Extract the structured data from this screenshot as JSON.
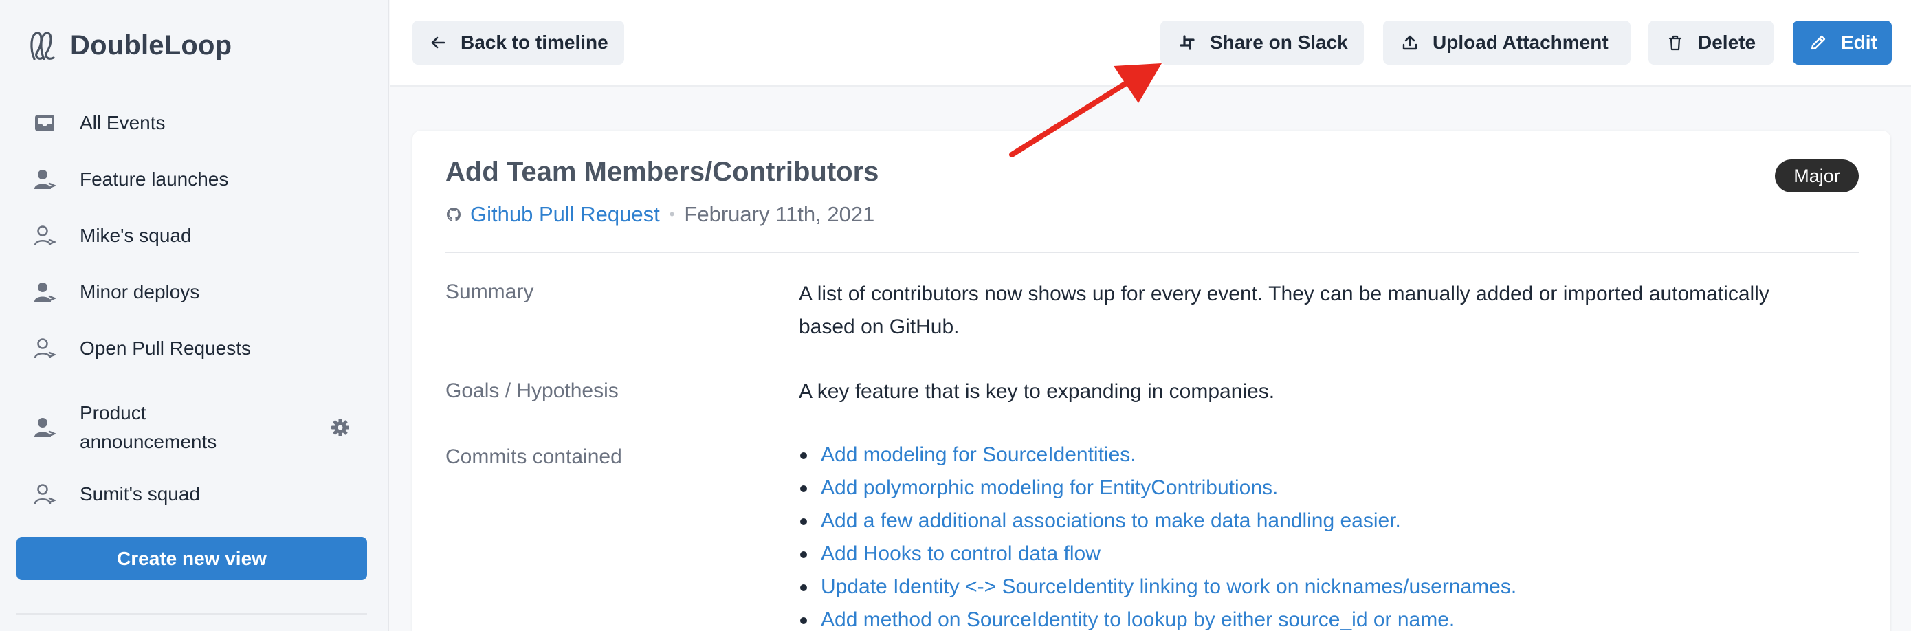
{
  "brand": {
    "name": "DoubleLoop"
  },
  "sidebar": {
    "items": [
      {
        "label": "All Events",
        "icon": "inbox-icon"
      },
      {
        "label": "Feature launches",
        "icon": "user-filled-icon"
      },
      {
        "label": "Mike's squad",
        "icon": "user-outline-icon"
      },
      {
        "label": "Minor deploys",
        "icon": "user-filled-icon"
      },
      {
        "label": "Open Pull Requests",
        "icon": "user-outline-icon"
      },
      {
        "label": "Product announcements",
        "icon": "user-filled-icon",
        "settings_icon": "gear-icon"
      },
      {
        "label": "Sumit's squad",
        "icon": "user-outline-icon"
      }
    ],
    "create_button": "Create new view"
  },
  "toolbar": {
    "back_label": "Back to timeline",
    "slack_label": "Share on Slack",
    "upload_label": "Upload Attachment",
    "delete_label": "Delete",
    "edit_label": "Edit"
  },
  "event": {
    "title": "Add Team Members/Contributors",
    "badge": "Major",
    "source": "Github Pull Request",
    "separator": "•",
    "date": "February 11th, 2021",
    "fields": {
      "summary_label": "Summary",
      "summary_value": "A list of contributors now shows up for every event. They can be manually added or imported automatically based on GitHub.",
      "goals_label": "Goals / Hypothesis",
      "goals_value": "A key feature that is key to expanding in companies.",
      "commits_label": "Commits contained"
    },
    "commits": [
      "Add modeling for SourceIdentities.",
      "Add polymorphic modeling for EntityContributions.",
      "Add a few additional associations to make data handling easier.",
      "Add Hooks to control data flow",
      "Update Identity <-> SourceIdentity linking to work on nicknames/usernames.",
      "Add method on SourceIdentity to lookup by either source_id or name."
    ]
  },
  "colors": {
    "accent": "#2f80cf",
    "badge_bg": "#2d2d2d",
    "annotation": "#e8281e"
  }
}
